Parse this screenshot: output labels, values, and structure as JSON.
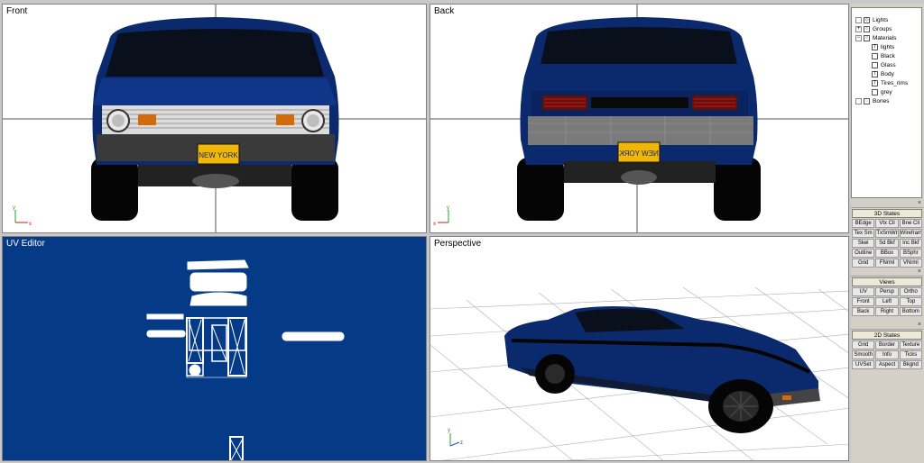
{
  "viewports": {
    "front": {
      "label": "Front"
    },
    "back": {
      "label": "Back"
    },
    "uv": {
      "label": "UV Editor"
    },
    "perspective": {
      "label": "Perspective"
    }
  },
  "plates": {
    "front": "NEW YORK",
    "back": "NEW YORK"
  },
  "tree": {
    "items": [
      {
        "label": "Lights",
        "indent": 0
      },
      {
        "label": "Groups",
        "indent": 0
      },
      {
        "label": "Materials",
        "indent": 0
      },
      {
        "label": "lights",
        "indent": 1
      },
      {
        "label": "Black",
        "indent": 1
      },
      {
        "label": "Glass",
        "indent": 1
      },
      {
        "label": "Body",
        "indent": 1
      },
      {
        "label": "Tires_rims",
        "indent": 1
      },
      {
        "label": "grey",
        "indent": 1
      },
      {
        "label": "Bones",
        "indent": 0
      }
    ]
  },
  "states3d": {
    "title": "3D States",
    "buttons": [
      "BEdge",
      "Vtx Cll",
      "Bne Cll",
      "Tex Sm",
      "TxSmWr",
      "Wireframe",
      "Skel",
      "Sd Bkf",
      "Inc Bkf",
      "Outline",
      "BBox",
      "BSphr",
      "Grid",
      "FNrml",
      "VNrml"
    ]
  },
  "views": {
    "title": "Views",
    "buttons": [
      "UV",
      "Persp",
      "Ortho",
      "Front",
      "Left",
      "Top",
      "Back",
      "Right",
      "Bottom"
    ]
  },
  "states2d": {
    "title": "2D States",
    "buttons": [
      "Grid",
      "Border",
      "Texture",
      "Smooth",
      "Info",
      "Ticks",
      "UVSet",
      "Aspect",
      "Bkgnd"
    ]
  },
  "colors": {
    "car_body": "#0b2a6e",
    "uv_background": "#053a86",
    "plate": "#f2b705"
  }
}
